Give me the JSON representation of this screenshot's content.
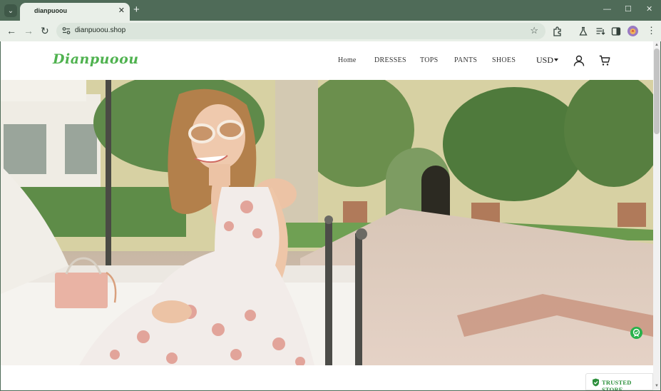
{
  "browser": {
    "tab_title": "dianpuoou",
    "tab_close_glyph": "✕",
    "new_tab_glyph": "+",
    "url": "dianpuoou.shop",
    "window_controls": {
      "minimize": "—",
      "maximize": "☐",
      "close": "✕"
    }
  },
  "site": {
    "logo": "Dianpuoou",
    "brand_color": "#4fb24f",
    "nav": [
      "Home",
      "DRESSES",
      "TOPS",
      "PANTS",
      "SHOES"
    ],
    "currency": "USD"
  },
  "badge": {
    "label": "TRUSTED STORE",
    "color": "#2c8f3b"
  },
  "icons": [
    "tab-search-icon",
    "close-icon",
    "plus-icon",
    "back-arrow-icon",
    "forward-arrow-icon",
    "reload-icon",
    "site-settings-icon",
    "star-icon",
    "extensions-icon",
    "labs-icon",
    "reading-list-icon",
    "side-panel-icon",
    "profile-avatar-icon",
    "kebab-menu-icon",
    "user-icon",
    "cart-icon",
    "shield-check-icon"
  ]
}
